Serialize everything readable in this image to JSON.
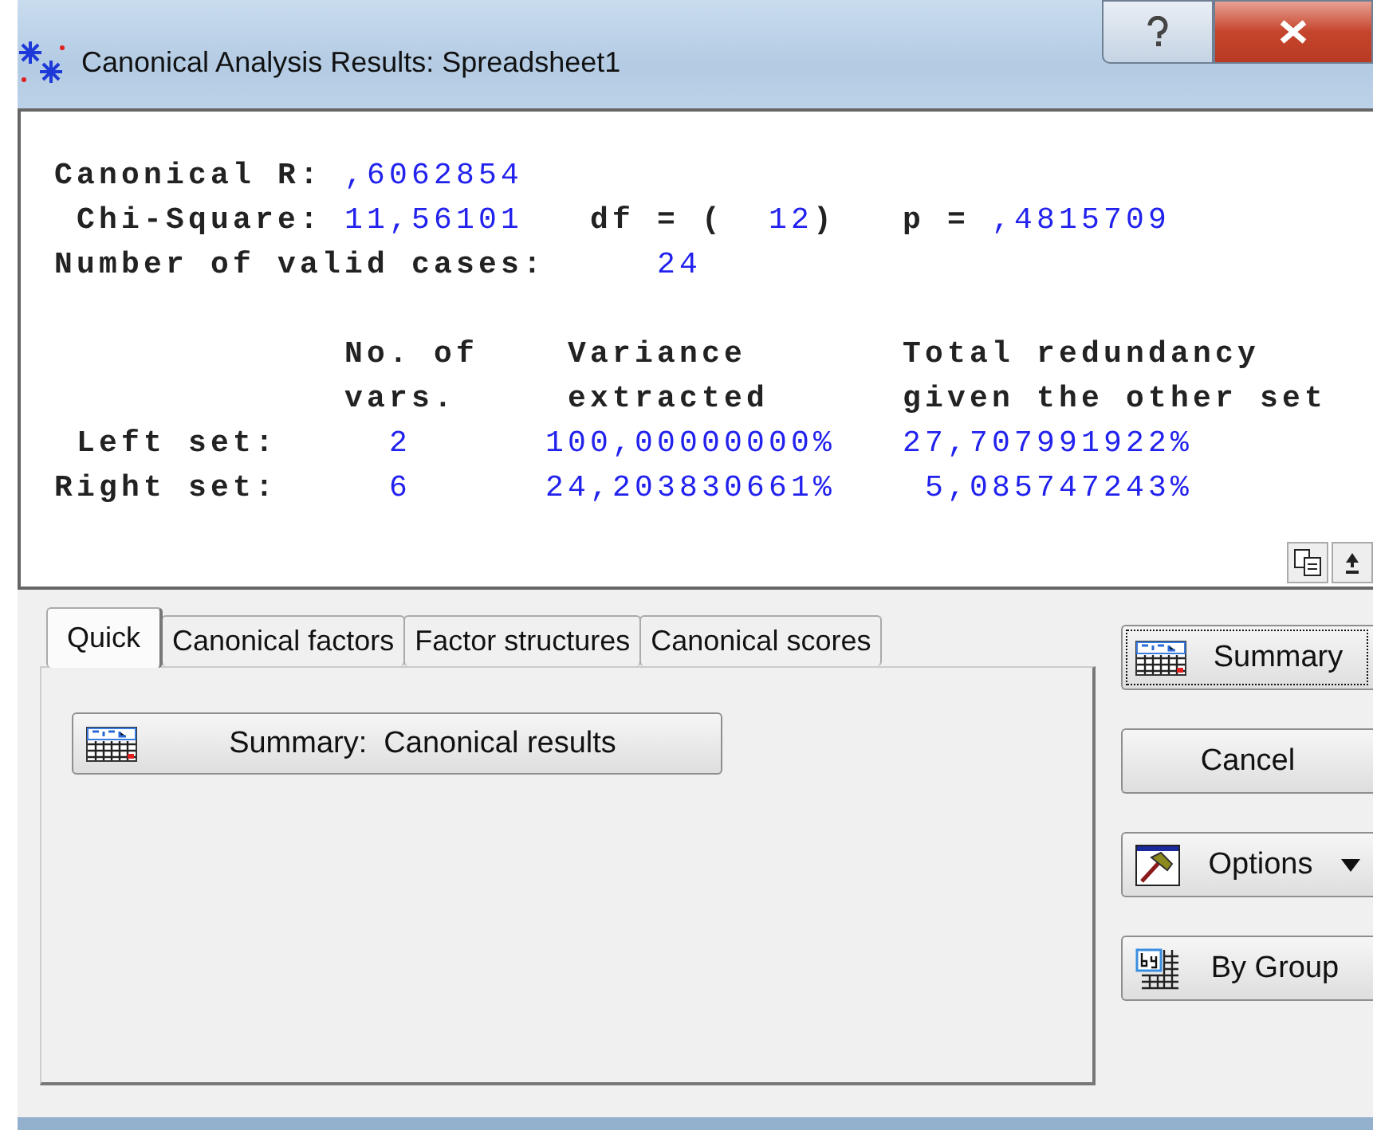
{
  "window": {
    "title": "Canonical Analysis Results: Spreadsheet1"
  },
  "output": {
    "summary_lines": [
      {
        "segments": [
          {
            "text": "Canonical R:",
            "kind": "label"
          },
          {
            "text": ",6062854",
            "kind": "value"
          }
        ]
      },
      {
        "segments": [
          {
            "text": "Chi-Square:",
            "kind": "label"
          },
          {
            "text": "11,56101",
            "kind": "value"
          },
          {
            "text": "df = (",
            "kind": "label"
          },
          {
            "text": "12",
            "kind": "value"
          },
          {
            "text": ")",
            "kind": "label"
          },
          {
            "text": "p =",
            "kind": "label"
          },
          {
            "text": ",4815709",
            "kind": "value"
          }
        ]
      },
      {
        "segments": [
          {
            "text": "Number of valid cases:",
            "kind": "label"
          },
          {
            "text": "24",
            "kind": "value"
          }
        ]
      }
    ],
    "table_lines": [
      {
        "segments": [
          {
            "text": "No. of",
            "kind": "label"
          },
          {
            "text": "Variance",
            "kind": "label"
          },
          {
            "text": "Total redundancy",
            "kind": "label"
          }
        ]
      },
      {
        "segments": [
          {
            "text": "vars.",
            "kind": "label"
          },
          {
            "text": "extracted",
            "kind": "label"
          },
          {
            "text": "given the other set",
            "kind": "label"
          }
        ]
      },
      {
        "segments": [
          {
            "text": "Left set:",
            "kind": "label"
          },
          {
            "text": "2",
            "kind": "value"
          },
          {
            "text": "100,00000000%",
            "kind": "value"
          },
          {
            "text": "27,707991922%",
            "kind": "value"
          }
        ]
      },
      {
        "segments": [
          {
            "text": "Right set:",
            "kind": "label"
          },
          {
            "text": "6",
            "kind": "value"
          },
          {
            "text": "24,203830661%",
            "kind": "value"
          },
          {
            "text": "5,085747243%",
            "kind": "value"
          }
        ]
      }
    ]
  },
  "tabs": [
    {
      "label": "Quick",
      "selected": true
    },
    {
      "label": "Canonical factors",
      "selected": false
    },
    {
      "label": "Factor structures",
      "selected": false
    },
    {
      "label": "Canonical scores",
      "selected": false
    }
  ],
  "quick_panel": {
    "buttons": [
      {
        "label": "Summary:  Canonical results",
        "kind": "summ"
      }
    ]
  },
  "side_buttons": [
    {
      "label": "Summary",
      "kind": "summ",
      "focused": true,
      "dropdown": false
    },
    {
      "label": "Cancel",
      "kind": "plain",
      "focused": false,
      "dropdown": false
    },
    {
      "label": "Options",
      "kind": "hammer",
      "focused": false,
      "dropdown": true
    },
    {
      "label": "By Group",
      "kind": "bygroup",
      "focused": false,
      "dropdown": false
    }
  ]
}
